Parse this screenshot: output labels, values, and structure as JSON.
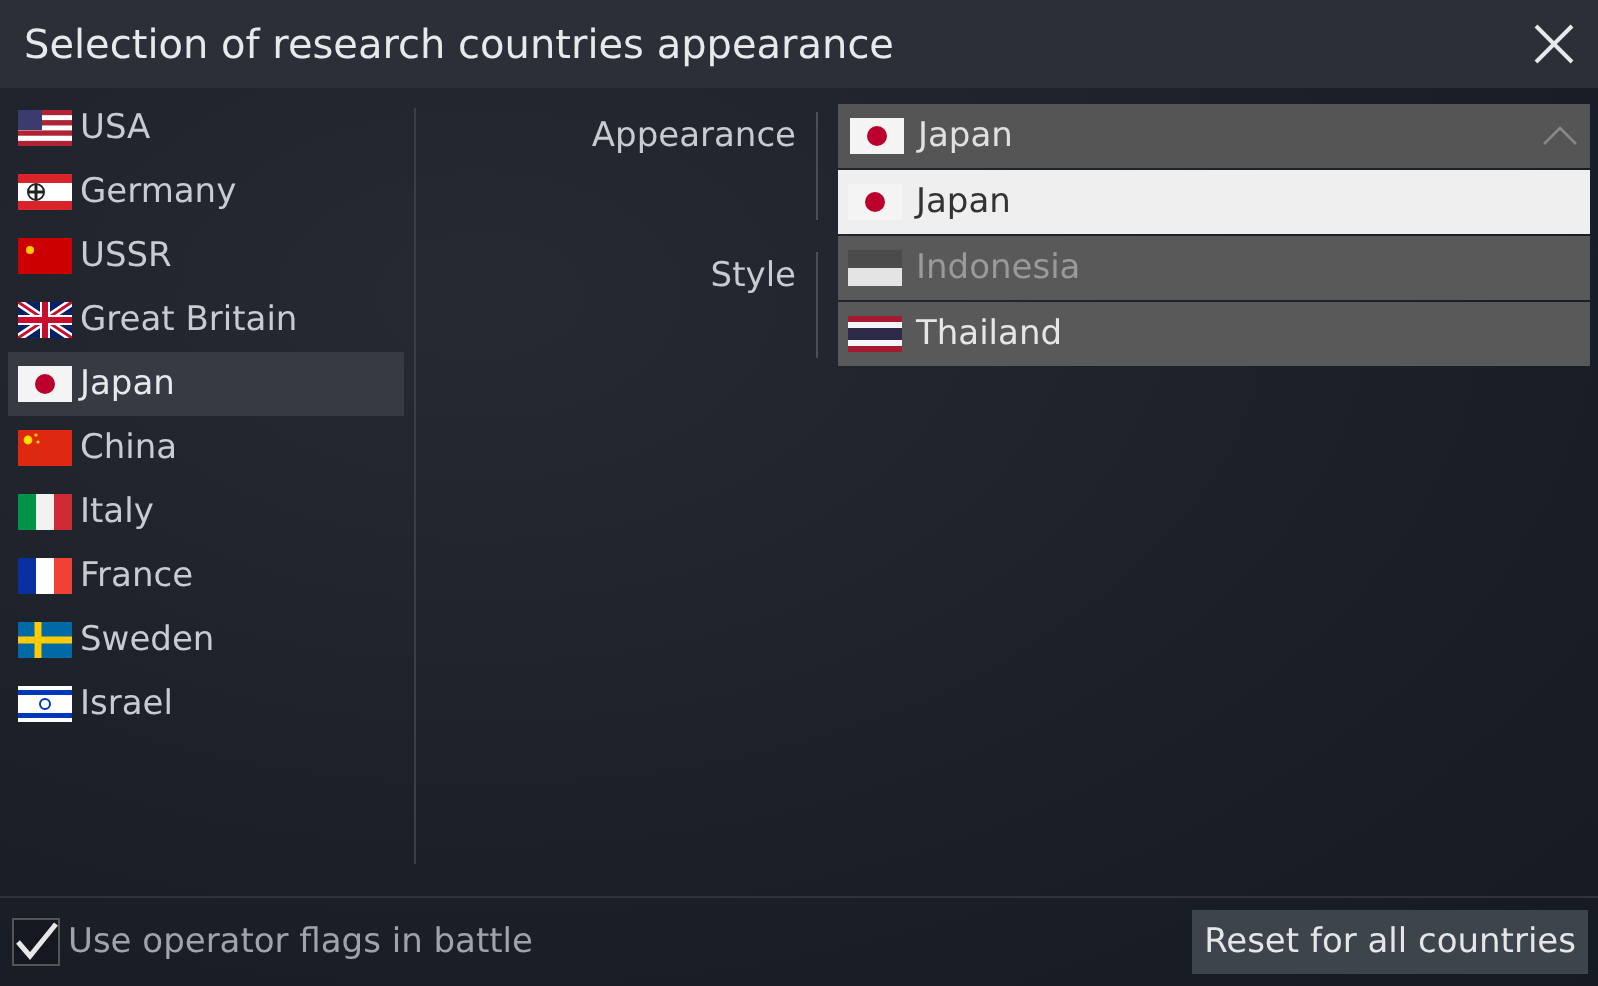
{
  "window": {
    "title": "Selection of research countries appearance"
  },
  "countries": [
    {
      "name": "USA",
      "kind": "usa",
      "selected": false
    },
    {
      "name": "Germany",
      "kind": "germany",
      "selected": false
    },
    {
      "name": "USSR",
      "kind": "ussr",
      "selected": false
    },
    {
      "name": "Great Britain",
      "kind": "britain",
      "selected": false
    },
    {
      "name": "Japan",
      "kind": "japan",
      "selected": true
    },
    {
      "name": "China",
      "kind": "china",
      "selected": false
    },
    {
      "name": "Italy",
      "kind": "italy",
      "selected": false
    },
    {
      "name": "France",
      "kind": "france",
      "selected": false
    },
    {
      "name": "Sweden",
      "kind": "sweden",
      "selected": false
    },
    {
      "name": "Israel",
      "kind": "israel",
      "selected": false
    }
  ],
  "appearance": {
    "label": "Appearance",
    "value": "Japan",
    "kind": "japan",
    "expanded": true,
    "options": [
      {
        "name": "Japan",
        "kind": "japan",
        "selected": true,
        "disabled": false
      },
      {
        "name": "Indonesia",
        "kind": "indonesia",
        "selected": false,
        "disabled": true
      },
      {
        "name": "Thailand",
        "kind": "thailand",
        "selected": false,
        "disabled": false
      }
    ]
  },
  "style": {
    "label": "Style"
  },
  "footer": {
    "checkbox": {
      "label": "Use operator flags in battle",
      "checked": true
    },
    "button": "Reset for all countries"
  }
}
